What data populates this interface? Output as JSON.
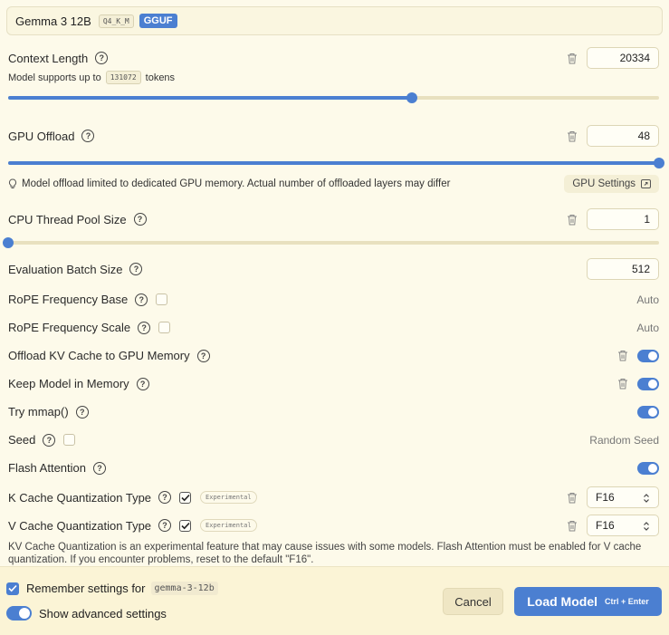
{
  "model": {
    "name": "Gemma 3 12B",
    "quant": "Q4_K_M",
    "format": "GGUF"
  },
  "context_length": {
    "label": "Context Length",
    "value": "20334",
    "support_prefix": "Model supports up to",
    "support_max": "131072",
    "support_suffix": "tokens",
    "slider_fraction": 0.62
  },
  "gpu_offload": {
    "label": "GPU Offload",
    "value": "48",
    "slider_fraction": 1.0,
    "hint": "Model offload limited to dedicated GPU memory. Actual number of offloaded layers may differ",
    "settings_button": "GPU Settings"
  },
  "cpu_thread_pool": {
    "label": "CPU Thread Pool Size",
    "value": "1",
    "slider_fraction": 0.0
  },
  "eval_batch": {
    "label": "Evaluation Batch Size",
    "value": "512"
  },
  "rope_base": {
    "label": "RoPE Frequency Base",
    "value": "Auto"
  },
  "rope_scale": {
    "label": "RoPE Frequency Scale",
    "value": "Auto"
  },
  "offload_kv": {
    "label": "Offload KV Cache to GPU Memory",
    "enabled": true
  },
  "keep_in_memory": {
    "label": "Keep Model in Memory",
    "enabled": true
  },
  "mmap": {
    "label": "Try mmap()",
    "enabled": true
  },
  "seed": {
    "label": "Seed",
    "value": "Random Seed"
  },
  "flash_attention": {
    "label": "Flash Attention",
    "enabled": true
  },
  "k_cache": {
    "label": "K Cache Quantization Type",
    "badge": "Experimental",
    "value": "F16"
  },
  "v_cache": {
    "label": "V Cache Quantization Type",
    "badge": "Experimental",
    "value": "F16"
  },
  "footnote": "KV Cache Quantization is an experimental feature that may cause issues with some models. Flash Attention must be enabled for V cache quantization. If you encounter problems, reset to the default \"F16\".",
  "footer": {
    "remember_label": "Remember settings for",
    "remember_model": "gemma-3-12b",
    "advanced_label": "Show advanced settings",
    "cancel": "Cancel",
    "load": "Load Model",
    "load_shortcut": "Ctrl + Enter"
  },
  "colors": {
    "accent": "#4b7fd1",
    "background": "#fdfaea"
  }
}
